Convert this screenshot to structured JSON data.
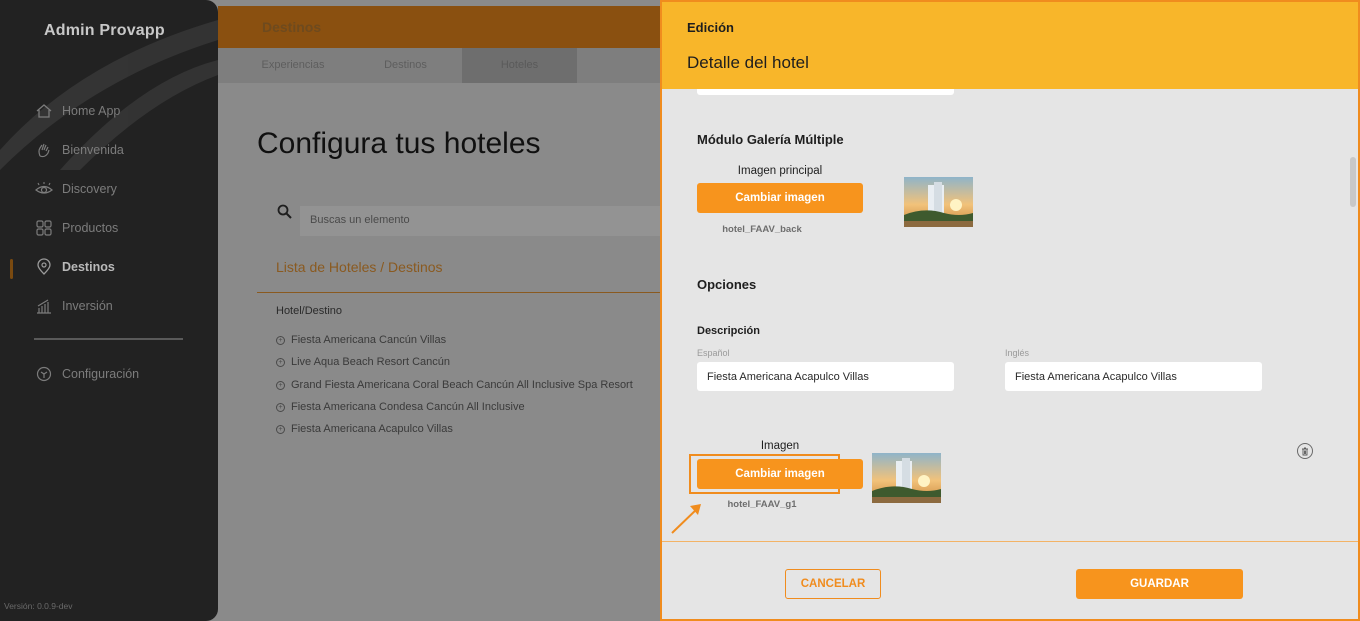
{
  "sidebar": {
    "brand": "Admin Provapp",
    "items": [
      {
        "label": "Home App",
        "icon": "home-icon"
      },
      {
        "label": "Bienvenida",
        "icon": "hand-wave-icon"
      },
      {
        "label": "Discovery",
        "icon": "eye-icon"
      },
      {
        "label": "Productos",
        "icon": "grid-icon"
      },
      {
        "label": "Destinos",
        "icon": "location-pin-icon",
        "active": true
      },
      {
        "label": "Inversión",
        "icon": "bar-chart-icon"
      }
    ],
    "settings_label": "Configuración",
    "version": "Versión: 0.0.9-dev"
  },
  "topbar": {
    "title": "Destinos"
  },
  "tabs": [
    "Experiencias",
    "Destinos",
    "Hoteles"
  ],
  "active_tab": "Hoteles",
  "main": {
    "heading": "Configura tus hoteles",
    "search_placeholder": "Buscas un elemento",
    "list_title": "Lista de Hoteles / Destinos",
    "column_header": "Hotel/Destino",
    "hotels": [
      "Fiesta Americana Cancún Villas",
      "Live Aqua Beach Resort Cancún",
      "Grand Fiesta Americana Coral Beach Cancún All Inclusive Spa Resort",
      "Fiesta Americana Condesa Cancún All Inclusive",
      "Fiesta Americana Acapulco Villas"
    ]
  },
  "modal": {
    "kicker": "Edición",
    "title": "Detalle del hotel",
    "gallery": {
      "section_title": "Módulo Galería Múltiple",
      "image_label": "Imagen principal",
      "button_label": "Cambiar imagen",
      "file_name": "hotel_FAAV_back"
    },
    "options": {
      "section_title": "Opciones",
      "description_label": "Descripción",
      "spanish_label": "Español",
      "english_label": "Inglés",
      "spanish_value": "Fiesta Americana Acapulco Villas",
      "english_value": "Fiesta Americana Acapulco Villas",
      "image_label": "Imagen",
      "button_label": "Cambiar imagen",
      "file_name": "hotel_FAAV_g1"
    },
    "cancel_label": "CANCELAR",
    "save_label": "GUARDAR"
  },
  "colors": {
    "accent": "#f7941d",
    "header": "#f8b62a",
    "sidebar": "#222222"
  }
}
